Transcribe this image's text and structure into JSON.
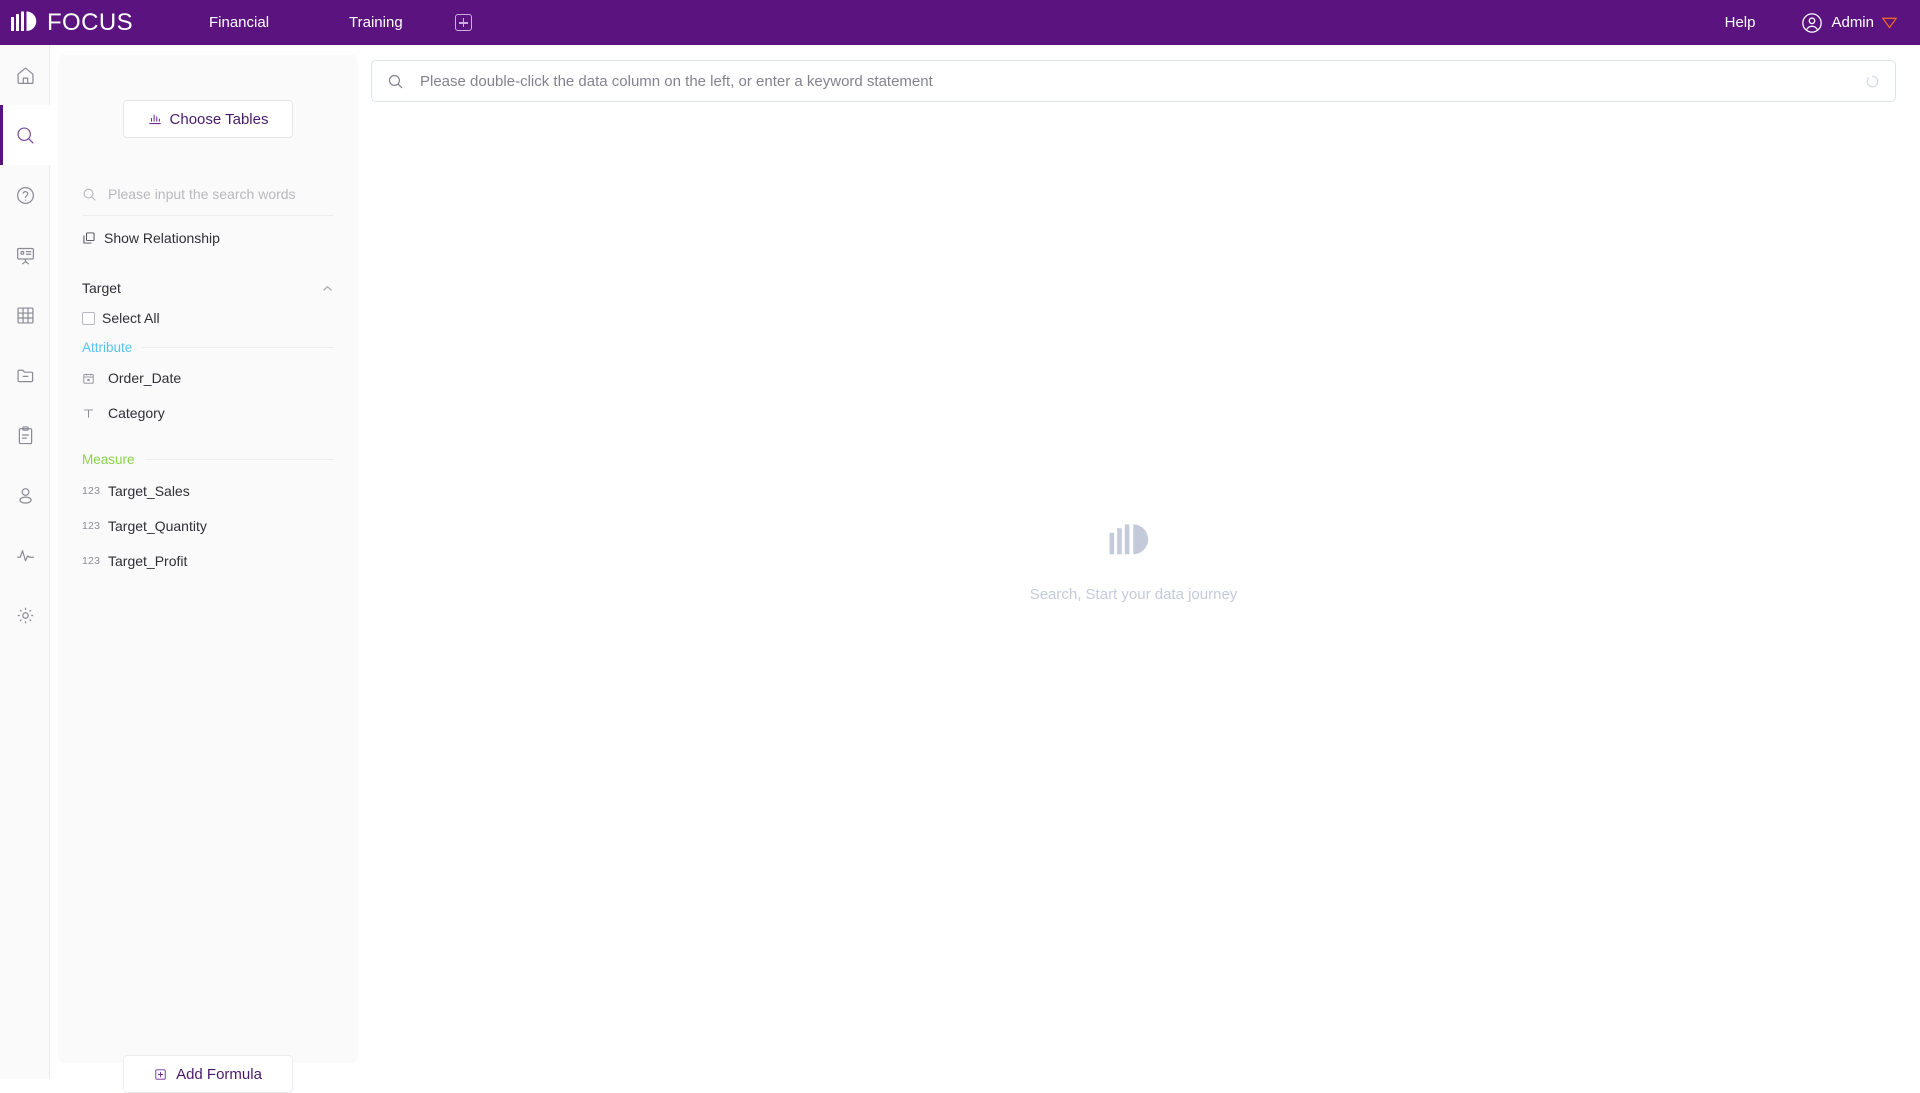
{
  "header": {
    "brand": "FOCUS",
    "logo_icon": "focus-logo-icon",
    "tabs": [
      {
        "label": "Financial",
        "name": "tab-financial"
      },
      {
        "label": "Training",
        "name": "tab-training"
      }
    ],
    "add_tab_icon": "plus-square-icon",
    "help_label": "Help",
    "user_name": "Admin",
    "avatar_icon": "user-circle-icon",
    "gem_icon": "gem-icon",
    "background_color": "#5b1380"
  },
  "rail": {
    "items": [
      {
        "icon": "home-icon",
        "name": "rail-item-home",
        "active": false
      },
      {
        "icon": "search-icon",
        "name": "rail-item-search",
        "active": true
      },
      {
        "icon": "question-circle-icon",
        "name": "rail-item-help",
        "active": false
      },
      {
        "icon": "presentation-icon",
        "name": "rail-item-presentation",
        "active": false
      },
      {
        "icon": "table-grid-icon",
        "name": "rail-item-table",
        "active": false
      },
      {
        "icon": "folder-minus-icon",
        "name": "rail-item-folder",
        "active": false
      },
      {
        "icon": "clipboard-icon",
        "name": "rail-item-clipboard",
        "active": false
      },
      {
        "icon": "user-icon",
        "name": "rail-item-user",
        "active": false
      },
      {
        "icon": "activity-pulse-icon",
        "name": "rail-item-activity",
        "active": false
      },
      {
        "icon": "gear-icon",
        "name": "rail-item-settings",
        "active": false
      }
    ],
    "active_indicator_color": "#5b1380"
  },
  "panel": {
    "choose_tables_label": "Choose Tables",
    "choose_tables_icon": "bar-chart-icon",
    "search_placeholder": "Please input the search words",
    "search_value": "",
    "search_icon": "search-icon",
    "show_relationship_label": "Show Relationship",
    "show_relationship_icon": "layers-link-icon",
    "table": {
      "name": "Target",
      "collapse_icon": "chevron-up-icon",
      "select_all_label": "Select All",
      "select_all_checked": false,
      "groups": [
        {
          "label": "Attribute",
          "color": "#58c3f0",
          "fields": [
            {
              "name": "Order_Date",
              "icon": "calendar-icon",
              "icon_glyph": "cal"
            },
            {
              "name": "Category",
              "icon": "text-type-icon",
              "icon_glyph": "T"
            }
          ]
        },
        {
          "label": "Measure",
          "color": "#8ad14e",
          "fields": [
            {
              "name": "Target_Sales",
              "icon": "number-icon",
              "icon_glyph": "123"
            },
            {
              "name": "Target_Quantity",
              "icon": "number-icon",
              "icon_glyph": "123"
            },
            {
              "name": "Target_Profit",
              "icon": "number-icon",
              "icon_glyph": "123"
            }
          ]
        }
      ]
    },
    "add_formula_label": "Add Formula",
    "add_formula_icon": "plus-square-icon"
  },
  "main": {
    "search_placeholder": "Please double-click the data column on the left, or enter a keyword statement",
    "search_value": "",
    "search_icon": "search-icon",
    "loading_icon": "spinner-icon",
    "empty_state": {
      "logo_icon": "focus-logo-icon",
      "text": "Search, Start your data journey"
    }
  }
}
